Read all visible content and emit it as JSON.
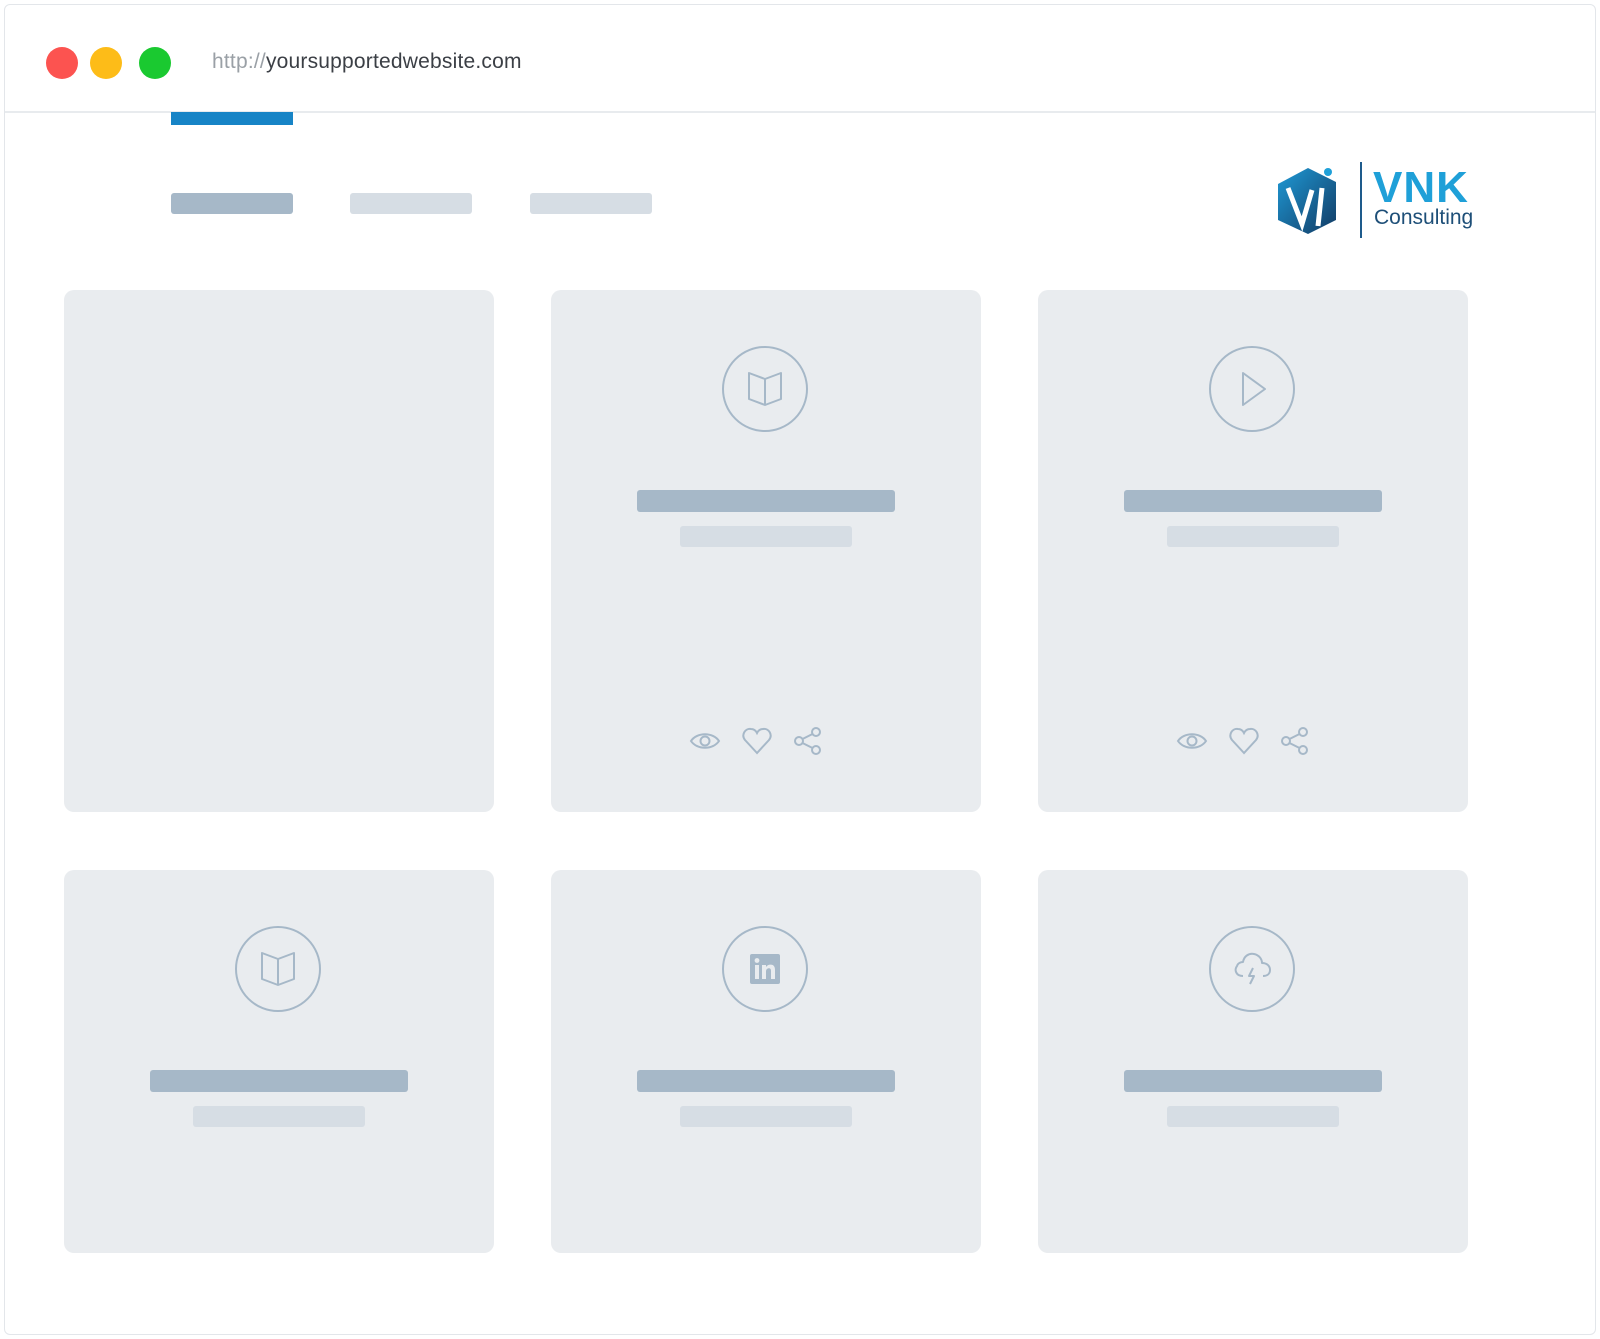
{
  "browser": {
    "url_protocol": "http://",
    "url_host": "yoursupportedwebsite.com"
  },
  "brand": {
    "name": "VNK",
    "tagline": "Consulting",
    "primary_color": "#1fa0d8",
    "secondary_color": "#1e4f78"
  },
  "colors": {
    "accent": "#1784c6",
    "placeholder_dark": "#a6b8c8",
    "placeholder_light": "#d6dde4",
    "card_bg": "#e9ecef"
  },
  "cards": [
    {
      "icon": "empty"
    },
    {
      "icon": "book-icon",
      "actions": [
        "eye-icon",
        "heart-icon",
        "share-icon"
      ]
    },
    {
      "icon": "play-icon",
      "actions": [
        "eye-icon",
        "heart-icon",
        "share-icon"
      ]
    },
    {
      "icon": "book-icon"
    },
    {
      "icon": "linkedin-icon"
    },
    {
      "icon": "cloud-lightning-icon"
    }
  ]
}
